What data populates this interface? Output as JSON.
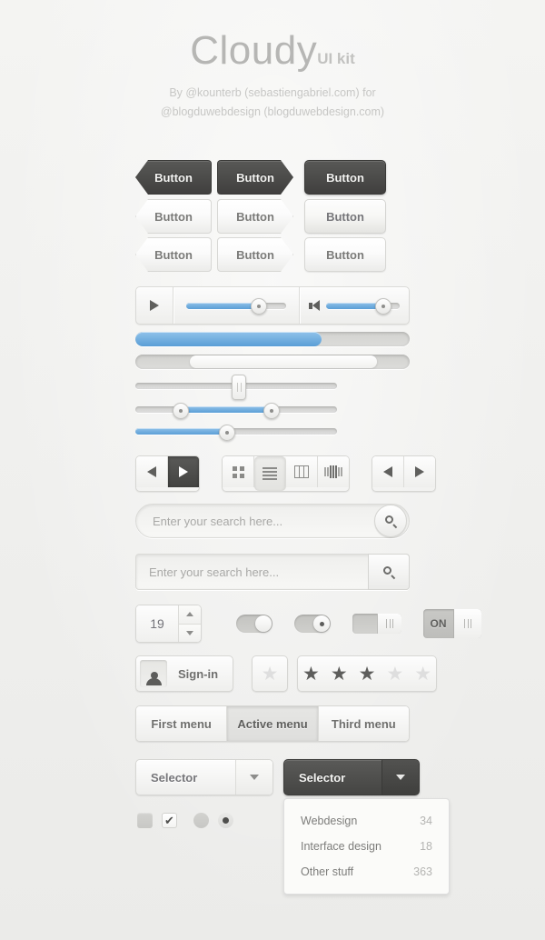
{
  "header": {
    "title": "Cloudy",
    "title_suffix": "UI kit",
    "credit_line1": "By @kounterb (sebastiengabriel.com) for",
    "credit_line2": "@blogduwebdesign (blogduwebdesign.com)"
  },
  "buttons": {
    "label": "Button",
    "rows": [
      {
        "style": "dark",
        "shapes": [
          "arrow-left",
          "arrow-right",
          "rect"
        ]
      },
      {
        "style": "light",
        "shapes": [
          "arrow-left",
          "arrow-right",
          "rect"
        ]
      },
      {
        "style": "light2",
        "shapes": [
          "arrow-left",
          "arrow-right",
          "rect"
        ]
      }
    ]
  },
  "player": {
    "play_icon": "play-icon",
    "seek_percent": 72,
    "volume_icon": "speaker-icon",
    "volume_percent": 76
  },
  "progress": {
    "bar_percent": 68,
    "range_start_percent": 20,
    "range_end_percent": 88
  },
  "sliders": [
    {
      "name": "vertical-grip-slider",
      "handle_percent": 51,
      "fill": false
    },
    {
      "name": "range-slider",
      "start_percent": 22,
      "end_percent": 67,
      "fill": true
    },
    {
      "name": "single-slider",
      "handle_percent": 45,
      "fill": true
    }
  ],
  "toolbar": {
    "prev_icon": "triangle-left-icon",
    "next_icon": "triangle-right-icon",
    "views": [
      "grid-view-icon",
      "list-view-icon",
      "column-view-icon",
      "coverflow-view-icon"
    ],
    "active_view_index": 1,
    "nav_back_icon": "triangle-left-icon",
    "nav_forward_icon": "triangle-right-icon"
  },
  "search": {
    "placeholder": "Enter your search here...",
    "value": "",
    "icon": "search-icon"
  },
  "stepper": {
    "value": "19",
    "up_icon": "caret-up-icon",
    "down_icon": "caret-down-icon"
  },
  "toggles": {
    "on_label": "ON"
  },
  "signin": {
    "label": "Sign-in",
    "icon": "person-icon"
  },
  "rating": {
    "single_star_filled": false,
    "stars_filled": 3,
    "stars_total": 5
  },
  "menu_tabs": {
    "items": [
      "First menu",
      "Active menu",
      "Third menu"
    ],
    "active_index": 1
  },
  "selector": {
    "label": "Selector",
    "caret_icon": "chevron-down-icon"
  },
  "dropdown": {
    "items": [
      {
        "label": "Webdesign",
        "count": "34"
      },
      {
        "label": "Interface design",
        "count": "18"
      },
      {
        "label": "Other stuff",
        "count": "363"
      }
    ]
  },
  "check_icon": "✔",
  "colors": {
    "accent_blue": "#5b9fd6",
    "dark": "#4c4c4a",
    "background": "#f2f2f0",
    "text_grey": "#76767a"
  }
}
